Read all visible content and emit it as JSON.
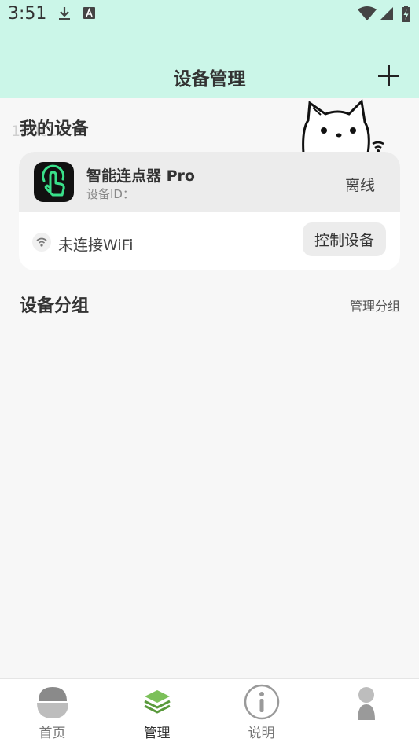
{
  "status_bar": {
    "time": "3:51"
  },
  "header": {
    "title": "设备管理"
  },
  "watermark": "1a0c18",
  "my_devices": {
    "title": "我的设备",
    "device": {
      "name": "智能连点器 Pro",
      "id_label": "设备ID：",
      "status": "离线",
      "wifi_status": "未连接WiFi",
      "control_label": "控制设备"
    }
  },
  "device_groups": {
    "title": "设备分组",
    "manage_label": "管理分组"
  },
  "bottom_nav": [
    {
      "label": "首页",
      "icon": "home-icon",
      "active": false
    },
    {
      "label": "管理",
      "icon": "layers-icon",
      "active": true
    },
    {
      "label": "说明",
      "icon": "info-icon",
      "active": false
    },
    {
      "label": "",
      "icon": "profile-icon",
      "active": false
    }
  ],
  "colors": {
    "header_bg": "#cbf6e8",
    "accent_green": "#7cc05a",
    "app_icon_green": "#39e08a"
  }
}
